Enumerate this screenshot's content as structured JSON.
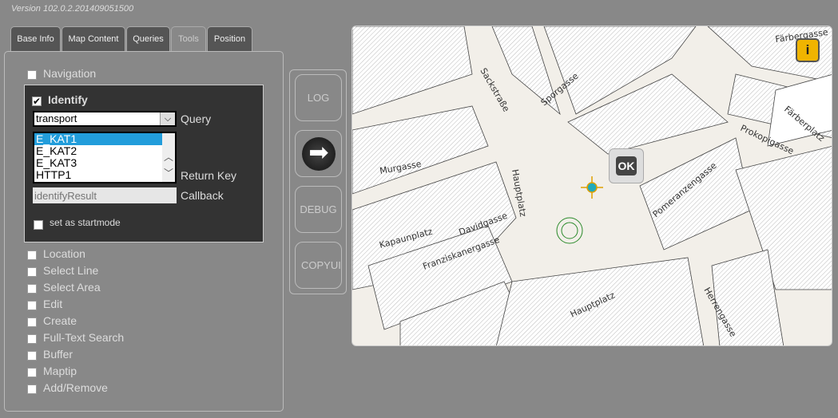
{
  "version": "Version 102.0.2.201409051500",
  "tabs": [
    {
      "label": "Base Info"
    },
    {
      "label": "Map Content"
    },
    {
      "label": "Queries"
    },
    {
      "label": "Tools",
      "active": true
    },
    {
      "label": "Position"
    }
  ],
  "tools": {
    "navigation": "Navigation",
    "identify": {
      "label": "Identify",
      "checked": true,
      "query_value": "transport",
      "query_label": "Query",
      "return_keys": [
        "E_KAT1",
        "E_KAT2",
        "E_KAT3",
        "HTTP1"
      ],
      "selected": "E_KAT1",
      "return_key_label": "Return Key",
      "callback_placeholder": "identifyResult",
      "callback_label": "Callback",
      "startmode": "set as startmode"
    },
    "others": [
      "Location",
      "Select Line",
      "Select Area",
      "Edit",
      "Create",
      "Full-Text Search",
      "Buffer",
      "Maptip",
      "Add/Remove"
    ]
  },
  "side_buttons": {
    "log": "LOG",
    "debug": "DEBUG",
    "copyui": "COPYUI"
  },
  "map": {
    "ok": "OK",
    "info": "i",
    "streets": [
      "Färbergasse",
      "Sackstraße",
      "Sporgasse",
      "Färberplatz",
      "Prokopigasse",
      "Murgasse",
      "Hauptplatz",
      "Pomeranzengasse",
      "Kapaunplatz",
      "Davidgasse",
      "Franziskanergasse",
      "Hauptplatz",
      "Herrengasse"
    ]
  },
  "colors": {
    "selection": "#229ddb",
    "info": "#f0b400"
  }
}
